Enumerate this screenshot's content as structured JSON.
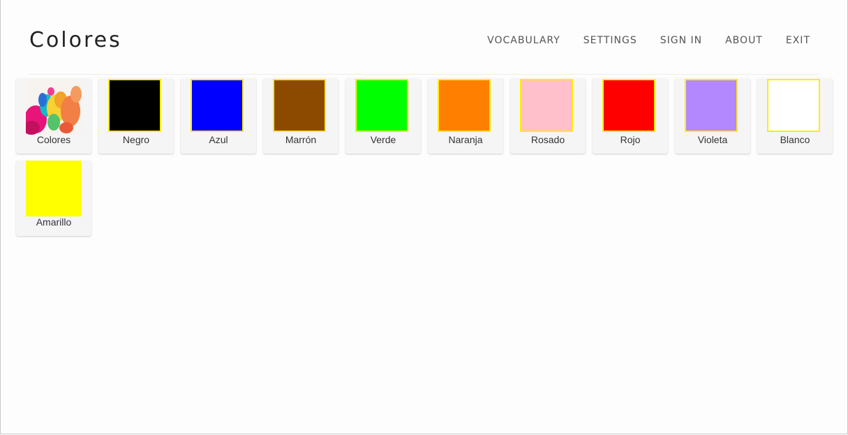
{
  "header": {
    "title": "Colores",
    "nav": [
      "VOCABULARY",
      "SETTINGS",
      "SIGN IN",
      "ABOUT",
      "EXIT"
    ]
  },
  "tiles": [
    {
      "label": "Colores",
      "color": null,
      "image": "colored-ink-splash-image"
    },
    {
      "label": "Negro",
      "color": "#000000",
      "bordered": true
    },
    {
      "label": "Azul",
      "color": "#0000ff",
      "bordered": true
    },
    {
      "label": "Marrón",
      "color": "#8b4a00",
      "bordered": true
    },
    {
      "label": "Verde",
      "color": "#00ff00",
      "bordered": true
    },
    {
      "label": "Naranja",
      "color": "#ff8000",
      "bordered": true
    },
    {
      "label": "Rosado",
      "color": "#ffc0cb",
      "bordered": true
    },
    {
      "label": "Rojo",
      "color": "#ff0000",
      "bordered": true
    },
    {
      "label": "Violeta",
      "color": "#b388ff",
      "bordered": true
    },
    {
      "label": "Blanco",
      "color": "#ffffff",
      "bordered": true
    },
    {
      "label": "Amarillo",
      "color": "#ffff00",
      "bordered": false
    }
  ],
  "colors": {
    "border_accent": "#ffee00",
    "tile_bg": "#f5f5f5"
  }
}
